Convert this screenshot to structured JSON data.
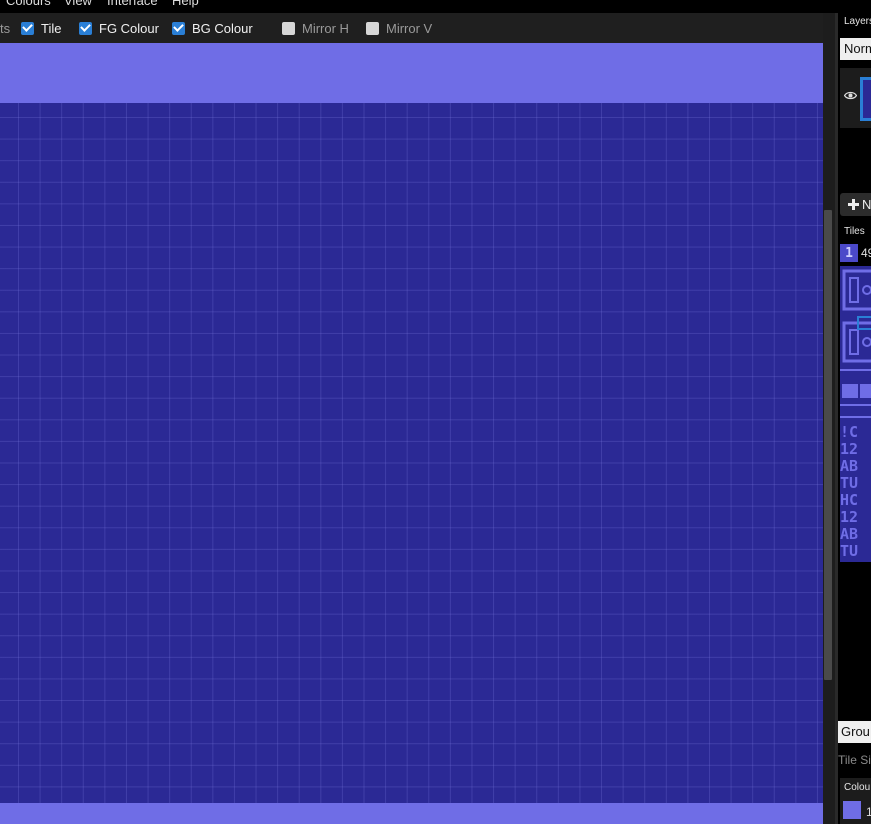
{
  "menu": {
    "items": [
      "Colours",
      "View",
      "Interface",
      "Help"
    ]
  },
  "toolbar": {
    "fragment": "ts",
    "options": [
      {
        "label": "Tile",
        "checked": true
      },
      {
        "label": "FG Colour",
        "checked": true
      },
      {
        "label": "BG Colour",
        "checked": true
      },
      {
        "label": "Mirror H",
        "checked": false
      },
      {
        "label": "Mirror V",
        "checked": false
      }
    ]
  },
  "colors": {
    "canvas_border": "#6f6de6",
    "canvas_fill": "#2b2995",
    "accent": "#2a7fd6"
  },
  "panel": {
    "layers_title": "Layers",
    "blend_mode": "Norm",
    "new_layer_label": "N",
    "tiles_title": "Tiles",
    "tile_index_glyph": "1",
    "tile_count": "49",
    "group_select": "Grou",
    "tile_size_label": "Tile Siz",
    "colours_title": "Colou",
    "colour_index": "1"
  },
  "tile_glyph_rows": [
    "!C",
    "12",
    "AB",
    "TU",
    "HC",
    "12",
    "AB",
    "TU"
  ]
}
